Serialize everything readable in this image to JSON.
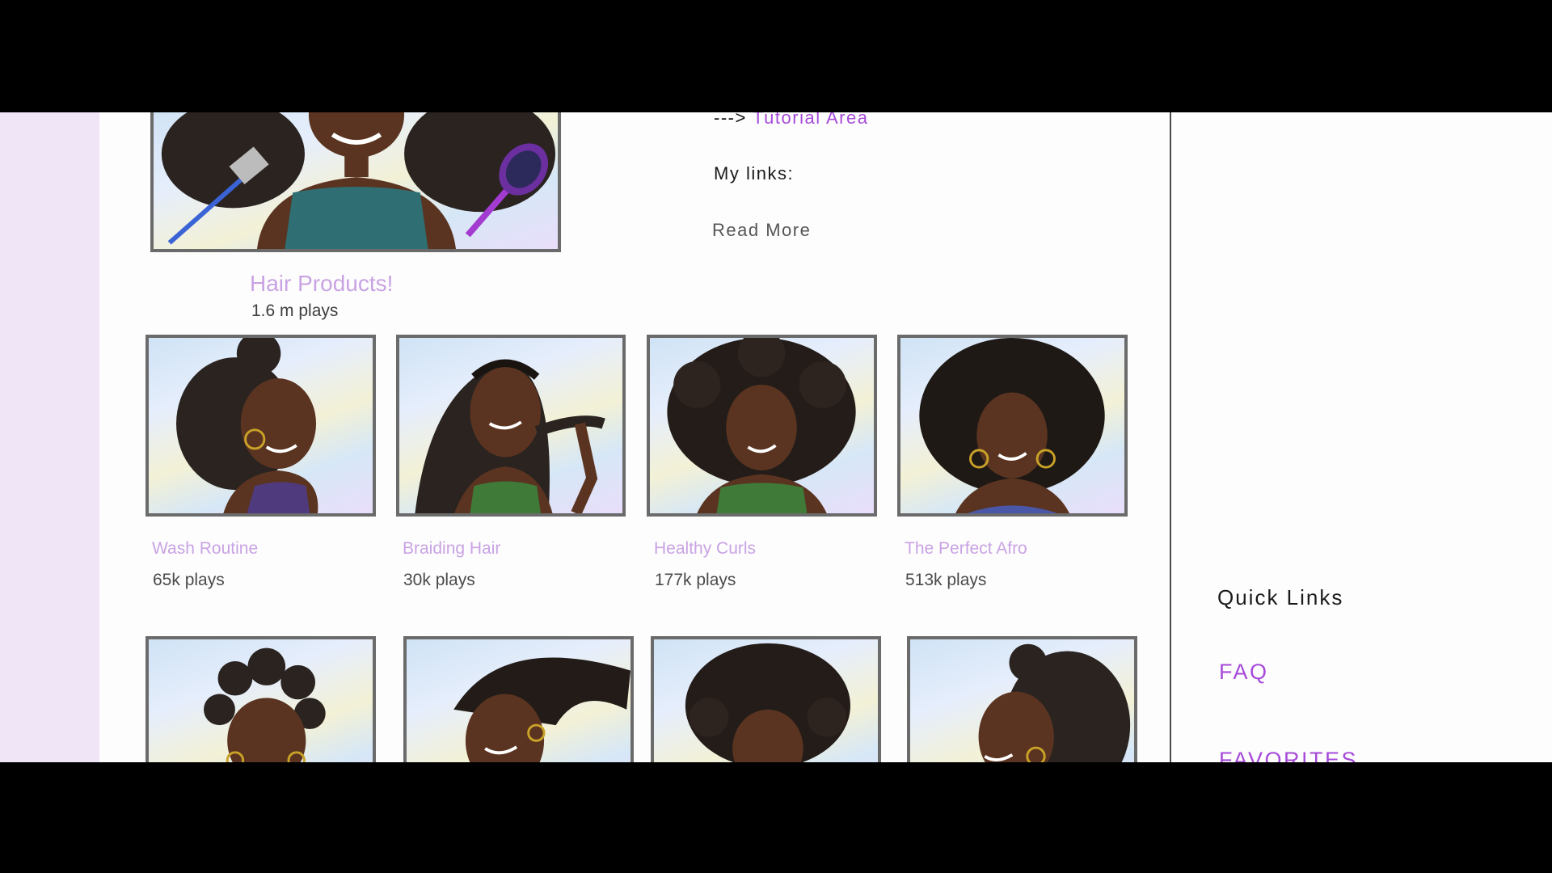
{
  "hero": {
    "title": "Hair Products!",
    "plays": "1.6 m plays"
  },
  "description": {
    "arrow": "--->",
    "tutorial_link": "Tutorial Area",
    "my_links": "My links:",
    "read_more": "Read More"
  },
  "cards_row1": [
    {
      "title": "Wash Routine",
      "plays": "65k plays"
    },
    {
      "title": "Braiding Hair",
      "plays": "30k plays"
    },
    {
      "title": "Healthy Curls",
      "plays": "177k plays"
    },
    {
      "title": "The Perfect Afro",
      "plays": "513k plays"
    }
  ],
  "sidebar": {
    "heading": "Quick Links",
    "links": [
      "FAQ",
      "FAVORITES"
    ]
  },
  "colors": {
    "accent_link": "#a64ad9",
    "card_title": "#c9a3e3",
    "left_rail": "#f0e4f7",
    "thumb_border": "#6b6b6b"
  }
}
